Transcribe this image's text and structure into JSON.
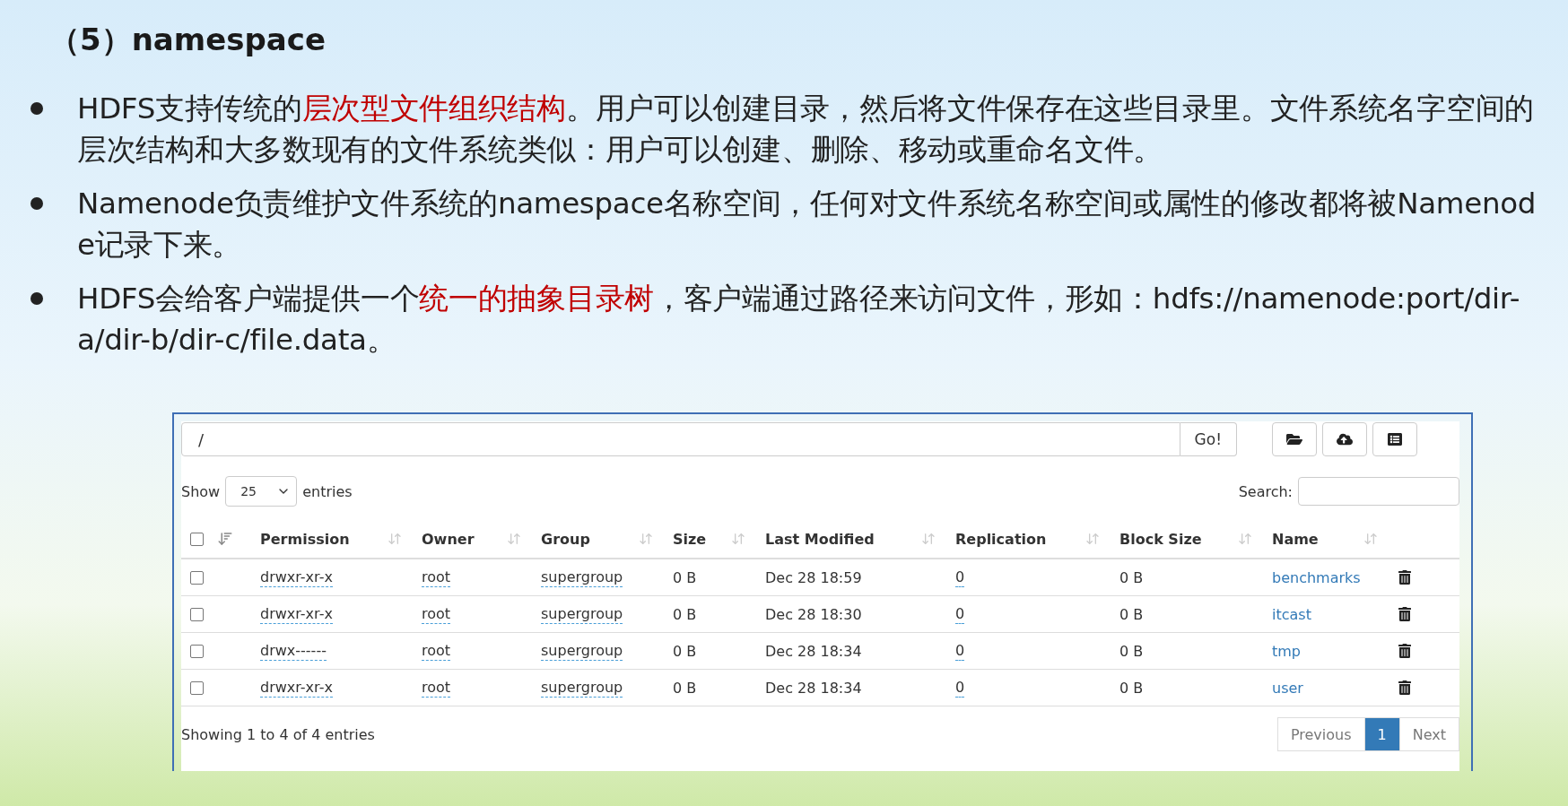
{
  "title": "（5）namespace",
  "bullets": [
    {
      "segments": [
        {
          "text": "HDFS支持传统的",
          "highlight": false
        },
        {
          "text": "层次型文件组织结构",
          "highlight": true
        },
        {
          "text": "。用户可以创建目录，然后将文件保存在这些目录里。文件系统名字空间的层次结构和大多数现有的文件系统类似：用户可以创建、删除、移动或重命名文件。",
          "highlight": false
        }
      ]
    },
    {
      "segments": [
        {
          "text": "Namenode负责维护文件系统的namespace名称空间，任何对文件系统名称空间或属性的修改都将被Namenode记录下来。",
          "highlight": false
        }
      ]
    },
    {
      "segments": [
        {
          "text": "HDFS会给客户端提供一个",
          "highlight": false
        },
        {
          "text": "统一的抽象目录树",
          "highlight": true
        },
        {
          "text": "，客户端通过路径来访问文件，形如：hdfs://namenode:port/dir-a/dir-b/dir-c/file.data。",
          "highlight": false
        }
      ]
    }
  ],
  "browser": {
    "path_field": {
      "value": "/"
    },
    "go_button": "Go!",
    "select_all_checked": false,
    "show_label": "Show",
    "page_size": "25",
    "entries_label": "entries",
    "search_label": "Search:",
    "columns": [
      "Permission",
      "Owner",
      "Group",
      "Size",
      "Last Modified",
      "Replication",
      "Block Size",
      "Name"
    ],
    "rows": [
      {
        "checked": false,
        "permission": "drwxr-xr-x",
        "owner": "root",
        "group": "supergroup",
        "size": "0 B",
        "last_modified": "Dec 28 18:59",
        "replication": "0",
        "block_size": "0 B",
        "name": "benchmarks"
      },
      {
        "checked": false,
        "permission": "drwxr-xr-x",
        "owner": "root",
        "group": "supergroup",
        "size": "0 B",
        "last_modified": "Dec 28 18:30",
        "replication": "0",
        "block_size": "0 B",
        "name": "itcast"
      },
      {
        "checked": false,
        "permission": "drwx------",
        "owner": "root",
        "group": "supergroup",
        "size": "0 B",
        "last_modified": "Dec 28 18:34",
        "replication": "0",
        "block_size": "0 B",
        "name": "tmp"
      },
      {
        "checked": false,
        "permission": "drwxr-xr-x",
        "owner": "root",
        "group": "supergroup",
        "size": "0 B",
        "last_modified": "Dec 28 18:34",
        "replication": "0",
        "block_size": "0 B",
        "name": "user"
      }
    ],
    "footer": "Showing 1 to 4 of 4 entries",
    "pagination": [
      {
        "label": "Previous",
        "selected": false
      },
      {
        "label": "1",
        "selected": true
      },
      {
        "label": "Next",
        "selected": false
      }
    ]
  }
}
